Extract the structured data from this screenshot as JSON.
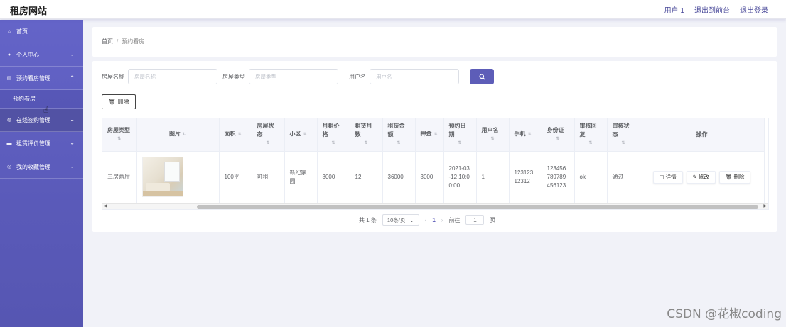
{
  "header": {
    "brand": "租房网站",
    "user": "用户 1",
    "to_front": "退出到前台",
    "logout": "退出登录"
  },
  "sidebar": {
    "items": [
      {
        "label": "首页",
        "icon": "home-icon"
      },
      {
        "label": "个人中心",
        "icon": "user-icon"
      },
      {
        "label": "预约看房管理",
        "icon": "doc-icon",
        "sub": "预约看房"
      },
      {
        "label": "在线签约管理",
        "icon": "globe-icon"
      },
      {
        "label": "租赁评价管理",
        "icon": "comment-icon"
      },
      {
        "label": "我的收藏管理",
        "icon": "star-icon"
      }
    ]
  },
  "breadcrumb": {
    "home": "首页",
    "sep": "/",
    "current": "预约看房"
  },
  "search": {
    "name_label": "房屋名称",
    "name_placeholder": "房屋名称",
    "type_label": "房屋类型",
    "type_placeholder": "房屋类型",
    "user_label": "用户名",
    "user_placeholder": "用户名"
  },
  "toolbar": {
    "delete_label": "删除"
  },
  "table": {
    "headers": [
      "房屋类型",
      "图片",
      "面积",
      "房屋状态",
      "小区",
      "月租价格",
      "租赁月数",
      "租赁金额",
      "押金",
      "预约日期",
      "用户名",
      "手机",
      "身份证",
      "审核回复",
      "审核状态",
      "操作"
    ],
    "rows": [
      {
        "type": "三房两厅",
        "area": "100平",
        "status": "可租",
        "community": "新纪家园",
        "monthly": "3000",
        "months": "12",
        "amount": "36000",
        "deposit": "3000",
        "date": "2021-03-12 10:00:00",
        "username": "1",
        "phone": "12312312312",
        "idcard": "123456789789456123",
        "reply": "ok",
        "audit": "通过"
      }
    ],
    "ops": {
      "detail": "详情",
      "edit": "修改",
      "delete": "删除"
    }
  },
  "pager": {
    "total": "共 1 条",
    "size": "10条/页",
    "page": "1",
    "goto": "前往",
    "goto_value": "1",
    "unit": "页"
  },
  "watermark": "CSDN @花椒coding",
  "colors": {
    "sidebar": "#5d5db8",
    "accent": "#5d5db8"
  }
}
